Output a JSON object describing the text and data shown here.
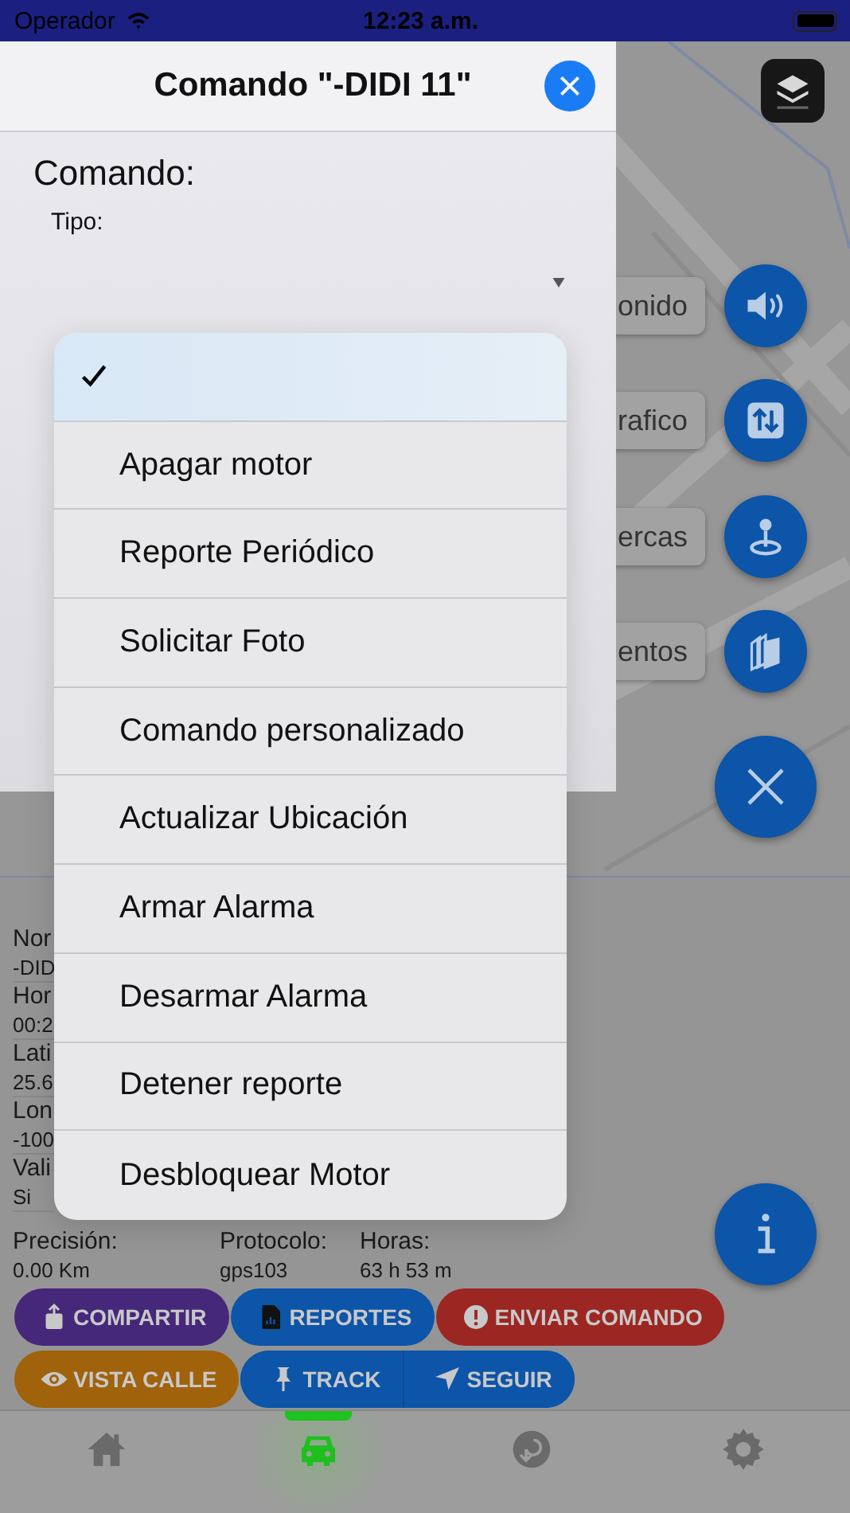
{
  "status_bar": {
    "carrier": "Operador",
    "time": "12:23 a.m."
  },
  "dialog": {
    "title": "Comando \"-DIDI 11\"",
    "section": "Comando:",
    "field_label": "Tipo:"
  },
  "dropdown_menu": {
    "items": [
      {
        "selected": true
      },
      {
        "label": "Apagar motor",
        "selected": false
      },
      {
        "label": "Reporte Periódico",
        "selected": false
      },
      {
        "label": "Solicitar Foto",
        "selected": false
      },
      {
        "label": "Comando personalizado",
        "selected": false
      },
      {
        "label": "Actualizar Ubicación",
        "selected": false
      },
      {
        "label": "Armar Alarma",
        "selected": false
      },
      {
        "label": "Desarmar Alarma",
        "selected": false
      },
      {
        "label": "Detener reporte",
        "selected": false
      },
      {
        "label": "Desbloquear Motor",
        "selected": false
      }
    ]
  },
  "map_actions": [
    {
      "label": "onido",
      "kind": "sound"
    },
    {
      "label": "rafico",
      "kind": "traffic"
    },
    {
      "label": "ercas",
      "kind": "geofence"
    },
    {
      "label": "entos",
      "kind": "events"
    }
  ],
  "vehicle_info": {
    "fields": [
      {
        "label": "Nor",
        "value": "-DID"
      },
      {
        "label": "Hor",
        "value": "00:2"
      },
      {
        "label": "Lati",
        "value": "25.6"
      },
      {
        "label": "Lon",
        "value": "-100"
      },
      {
        "label": "Vali",
        "value": "Si"
      }
    ],
    "stats": [
      {
        "label": "Precisión:",
        "value": "0.00 Km"
      },
      {
        "label": "Protocolo:",
        "value": "gps103"
      },
      {
        "label": "Horas:",
        "value": "63 h 53 m"
      }
    ]
  },
  "actions_top": [
    {
      "label": "COMPARTIR",
      "kind": "share",
      "color": "#46287a"
    },
    {
      "label": "REPORTES",
      "kind": "report",
      "color": "#0c55a8"
    },
    {
      "label": "ENVIAR COMANDO",
      "kind": "alert",
      "color": "#9c2622"
    }
  ],
  "actions_bottom": [
    {
      "label": "VISTA CALLE",
      "kind": "eye",
      "color": "#a0620a"
    },
    {
      "label": "TRACK",
      "kind": "pin",
      "color": "#0c55a8"
    },
    {
      "label": "SEGUIR",
      "kind": "navigate",
      "color": "#0c55a8"
    }
  ],
  "tab_bar": [
    {
      "kind": "home",
      "selected": false
    },
    {
      "kind": "car",
      "selected": true
    },
    {
      "kind": "history",
      "selected": false
    },
    {
      "kind": "settings",
      "selected": false
    }
  ]
}
